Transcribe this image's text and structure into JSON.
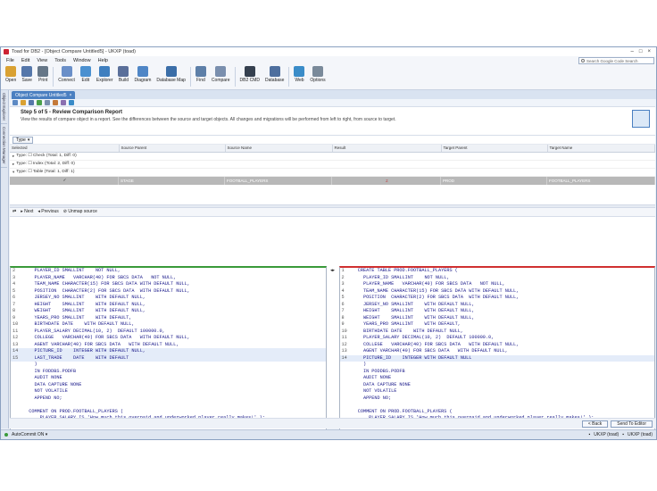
{
  "app": {
    "title": "Toad for DB2 - [Object Compare Untitled5] - UKXP (toad)",
    "window_controls": [
      "–",
      "□",
      "×"
    ]
  },
  "menu": [
    "File",
    "Edit",
    "View",
    "Tools",
    "Window",
    "Help"
  ],
  "search_placeholder": "Search Google Code Search",
  "toolbar": [
    {
      "label": "Open",
      "icon": "open-icon",
      "color": "#d9a132"
    },
    {
      "label": "Save",
      "icon": "save-icon",
      "color": "#5577aa"
    },
    {
      "label": "Print",
      "icon": "print-icon",
      "color": "#667788"
    },
    {
      "label": "Connect",
      "icon": "connect-icon",
      "color": "#6a8fc8"
    },
    {
      "label": "Edit",
      "icon": "edit-icon",
      "color": "#4a90d0"
    },
    {
      "label": "Explorer",
      "icon": "explorer-icon",
      "color": "#3f7fbf"
    },
    {
      "label": "Build",
      "icon": "build-icon",
      "color": "#5a6f9a"
    },
    {
      "label": "Diagram",
      "icon": "diagram-icon",
      "color": "#4f86c6"
    },
    {
      "label": "Database Map",
      "icon": "database-map-icon",
      "color": "#3b6ea8"
    },
    {
      "label": "Find",
      "icon": "find-icon",
      "color": "#5d7fa8"
    },
    {
      "label": "Compare",
      "icon": "compare-icon",
      "color": "#7a8fae"
    },
    {
      "label": "DB2 CMD",
      "icon": "db2-cmd-icon",
      "color": "#35404f"
    },
    {
      "label": "Database",
      "icon": "database-icon",
      "color": "#4e6f9e"
    },
    {
      "label": "Web",
      "icon": "web-icon",
      "color": "#3a8cc8"
    },
    {
      "label": "Options",
      "icon": "options-icon",
      "color": "#7a8a9a"
    }
  ],
  "side_tabs": [
    "Object Explorer",
    "Connection Manager"
  ],
  "doc_tab": "Object Compare Untitled5",
  "wizard": {
    "step": "Step 5 of 5 - Review Comparison Report",
    "description": "View the results of compare object in a report. See the differences between the source and target objects. All changes and migrations will be performed from left to right, from source to target."
  },
  "type_button": "Type",
  "grid": {
    "columns": [
      "Selected",
      "Source Parent",
      "Source Name",
      "Result",
      "Target Parent",
      "Target Name"
    ],
    "groups": [
      "Type: ☐ Check (Total: 1, Diff: 0)",
      "Type: ☐ Index (Total: 2, Diff: 0)",
      "Type: ☐ Table (Total: 1, Diff: 1)"
    ],
    "selected_row": {
      "selected": "✓",
      "source_parent": "STAGE",
      "source_name": "FOOTBALL_PLAYERS",
      "result": "≠",
      "target_parent": "PROD",
      "target_name": "FOOTBALL_PLAYERS"
    }
  },
  "diff_toolbar": {
    "next": "Next",
    "previous": "Previous",
    "unmap": "Unmap source"
  },
  "left_code": [
    {
      "n": "2",
      "t": "    PLAYER_ID SMALLINT    NOT NULL,"
    },
    {
      "n": "3",
      "t": "    PLAYER_NAME   VARCHAR(40) FOR SBCS DATA   NOT NULL,"
    },
    {
      "n": "4",
      "t": "    TEAM_NAME CHARACTER(15) FOR SBCS DATA WITH DEFAULT NULL,"
    },
    {
      "n": "5",
      "t": "    POSITION  CHARACTER(2) FOR SBCS DATA  WITH DEFAULT NULL,"
    },
    {
      "n": "6",
      "t": "    JERSEY_NO SMALLINT    WITH DEFAULT NULL,"
    },
    {
      "n": "7",
      "t": "    HEIGHT    SMALLINT    WITH DEFAULT NULL,"
    },
    {
      "n": "8",
      "t": "    WEIGHT    SMALLINT    WITH DEFAULT NULL,"
    },
    {
      "n": "9",
      "t": "    YEARS_PRO SMALLINT    WITH DEFAULT,"
    },
    {
      "n": "10",
      "t": "    BIRTHDATE DATE    WITH DEFAULT NULL,"
    },
    {
      "n": "11",
      "t": "    PLAYER_SALARY DECIMAL(10, 2)  DEFAULT 100000.0,"
    },
    {
      "n": "12",
      "t": "    COLLEGE   VARCHAR(40) FOR SBCS DATA   WITH DEFAULT NULL,"
    },
    {
      "n": "13",
      "t": "    AGENT VARCHAR(40) FOR SBCS DATA   WITH DEFAULT NULL,"
    },
    {
      "n": "14",
      "t": "    PICTURE_ID    INTEGER WITH DEFAULT NULL,",
      "hl": true
    },
    {
      "n": "15",
      "t": "    LAST_TRADE    DATE    WITH DEFAULT",
      "hl": true
    },
    {
      "n": "",
      "t": "    )"
    },
    {
      "n": "",
      "t": "    IN FODDBS.PODFB"
    },
    {
      "n": "",
      "t": "    AUDIT NONE"
    },
    {
      "n": "",
      "t": "    DATA CAPTURE NONE"
    },
    {
      "n": "",
      "t": "    NOT VOLATILE"
    },
    {
      "n": "",
      "t": "    APPEND NO;"
    },
    {
      "n": "",
      "t": ""
    },
    {
      "n": "",
      "t": "  COMMENT ON PROD.FOOTBALL_PLAYERS ("
    },
    {
      "n": "",
      "t": "      PLAYER_SALARY IS 'How much this overpaid and underworked player really makes!' );"
    }
  ],
  "right_code": [
    {
      "n": "1",
      "t": "  CREATE TABLE PROD.FOOTBALL_PLAYERS ("
    },
    {
      "n": "2",
      "t": "    PLAYER_ID SMALLINT    NOT NULL,"
    },
    {
      "n": "3",
      "t": "    PLAYER_NAME   VARCHAR(40) FOR SBCS DATA   NOT NULL,"
    },
    {
      "n": "4",
      "t": "    TEAM_NAME CHARACTER(15) FOR SBCS DATA WITH DEFAULT NULL,"
    },
    {
      "n": "5",
      "t": "    POSITION  CHARACTER(2) FOR SBCS DATA  WITH DEFAULT NULL,"
    },
    {
      "n": "6",
      "t": "    JERSEY_NO SMALLINT    WITH DEFAULT NULL,"
    },
    {
      "n": "7",
      "t": "    HEIGHT    SMALLINT    WITH DEFAULT NULL,"
    },
    {
      "n": "8",
      "t": "    WEIGHT    SMALLINT    WITH DEFAULT NULL,"
    },
    {
      "n": "9",
      "t": "    YEARS_PRO SMALLINT    WITH DEFAULT,"
    },
    {
      "n": "10",
      "t": "    BIRTHDATE DATE    WITH DEFAULT NULL,"
    },
    {
      "n": "11",
      "t": "    PLAYER_SALARY DECIMAL(10, 2)  DEFAULT 100000.0,"
    },
    {
      "n": "12",
      "t": "    COLLEGE   VARCHAR(40) FOR SBCS DATA   WITH DEFAULT NULL,"
    },
    {
      "n": "13",
      "t": "    AGENT VARCHAR(40) FOR SBCS DATA   WITH DEFAULT NULL,"
    },
    {
      "n": "14",
      "t": "    PICTURE_ID    INTEGER WITH DEFAULT NULL",
      "hl": true
    },
    {
      "n": "",
      "t": "    )"
    },
    {
      "n": "",
      "t": "    IN PODDBS.PODFB"
    },
    {
      "n": "",
      "t": "    AUDIT NONE"
    },
    {
      "n": "",
      "t": "    DATA CAPTURE NONE"
    },
    {
      "n": "",
      "t": "    NOT VOLATILE"
    },
    {
      "n": "",
      "t": "    APPEND NO;"
    },
    {
      "n": "",
      "t": ""
    },
    {
      "n": "",
      "t": "  COMMENT ON PROD.FOOTBALL_PLAYERS ("
    },
    {
      "n": "",
      "t": "      PLAYER_SALARY IS 'How much this overpaid and underworked player really makes!' );"
    }
  ],
  "buttons": {
    "back": "< Back",
    "send": "Send To Editor"
  },
  "status": {
    "autocommit": "AutoCommit ON ▾",
    "conn1": "UKXP (toad)",
    "conn2": "UKXP (toad)"
  }
}
